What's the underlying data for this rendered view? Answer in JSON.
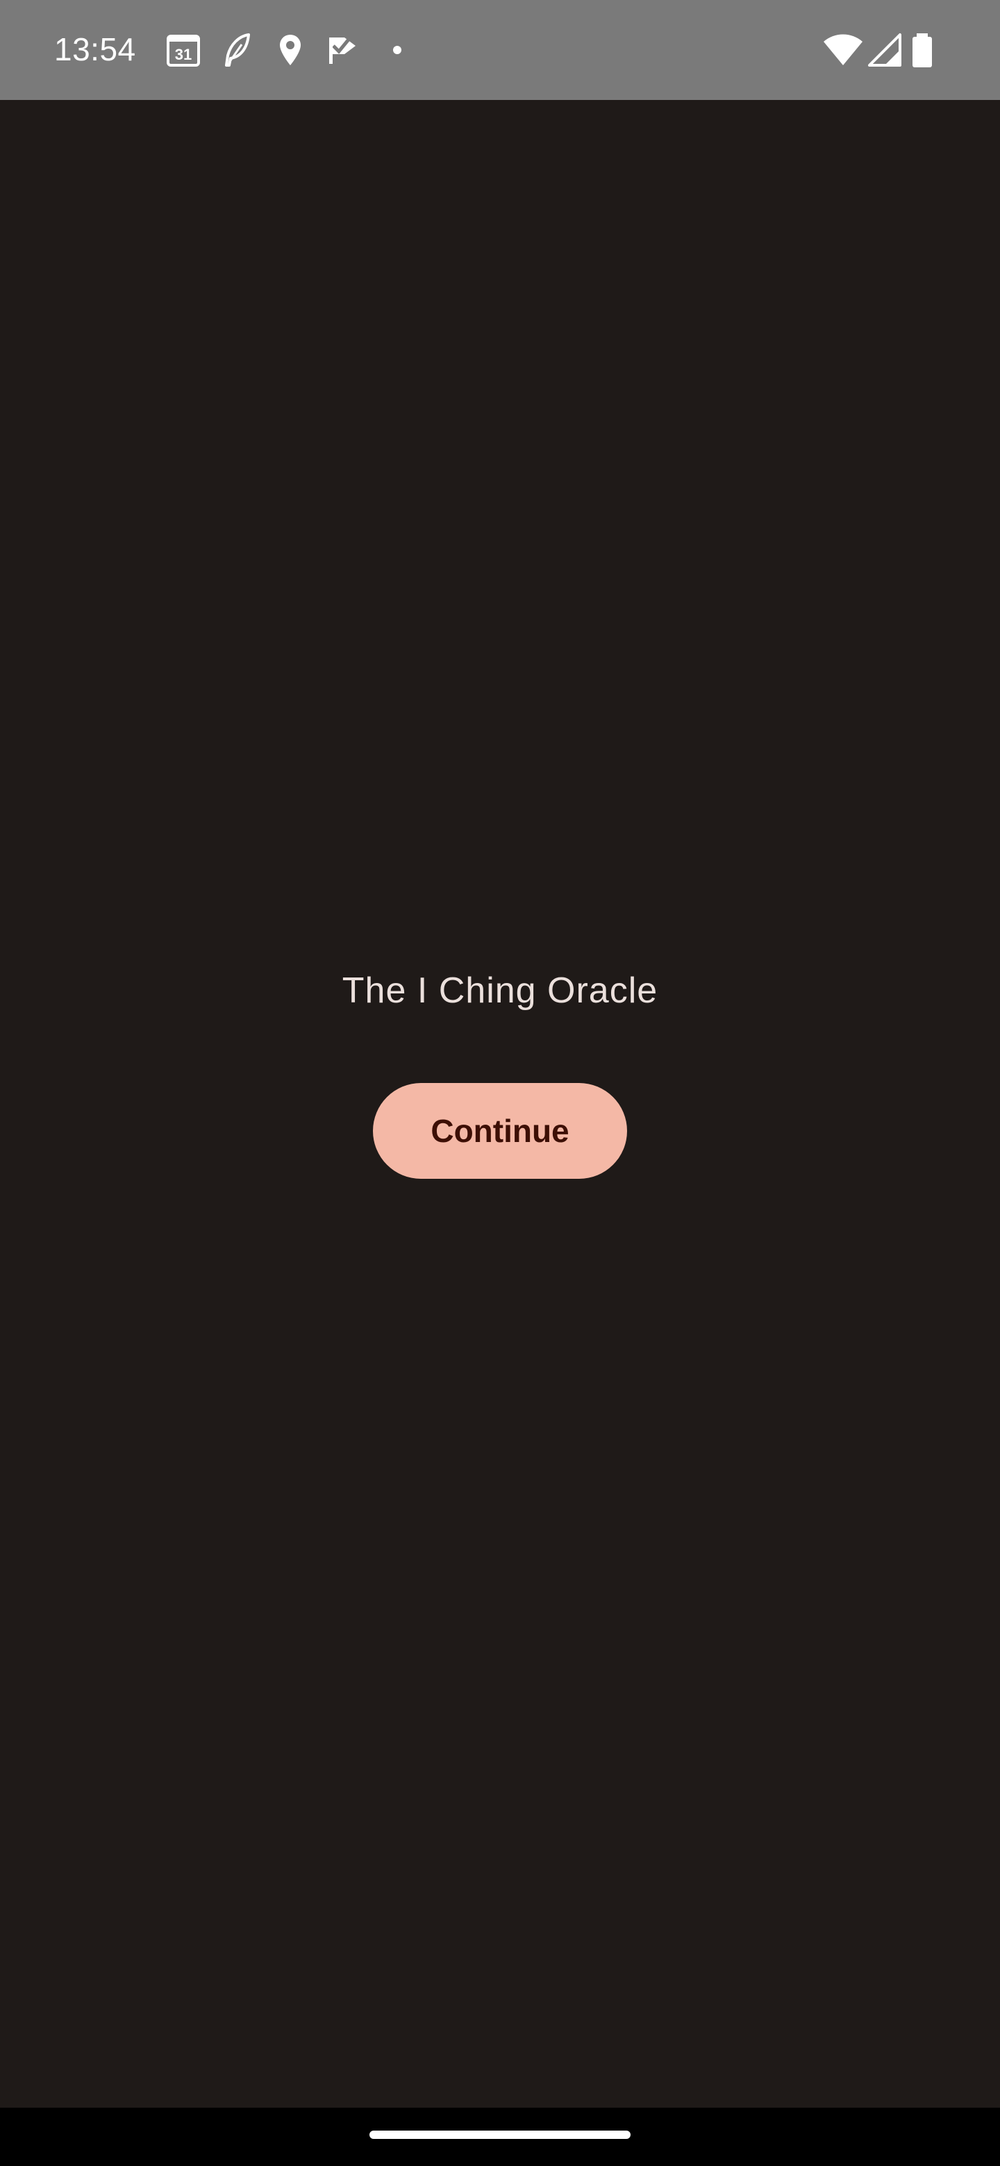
{
  "status_bar": {
    "time": "13:54",
    "calendar_day": "31",
    "left_icons": [
      "calendar-icon",
      "feather-icon",
      "location-pin-icon",
      "check-flag-icon",
      "dot-icon"
    ],
    "right_icons": [
      "wifi-icon",
      "cellular-signal-icon",
      "battery-icon"
    ],
    "background_color": "#7a7a7a"
  },
  "main": {
    "title": "The I Ching Oracle",
    "continue_label": "Continue",
    "background_color": "#1f1a18",
    "button_color": "#f4b8a6",
    "button_text_color": "#3d0f05"
  }
}
